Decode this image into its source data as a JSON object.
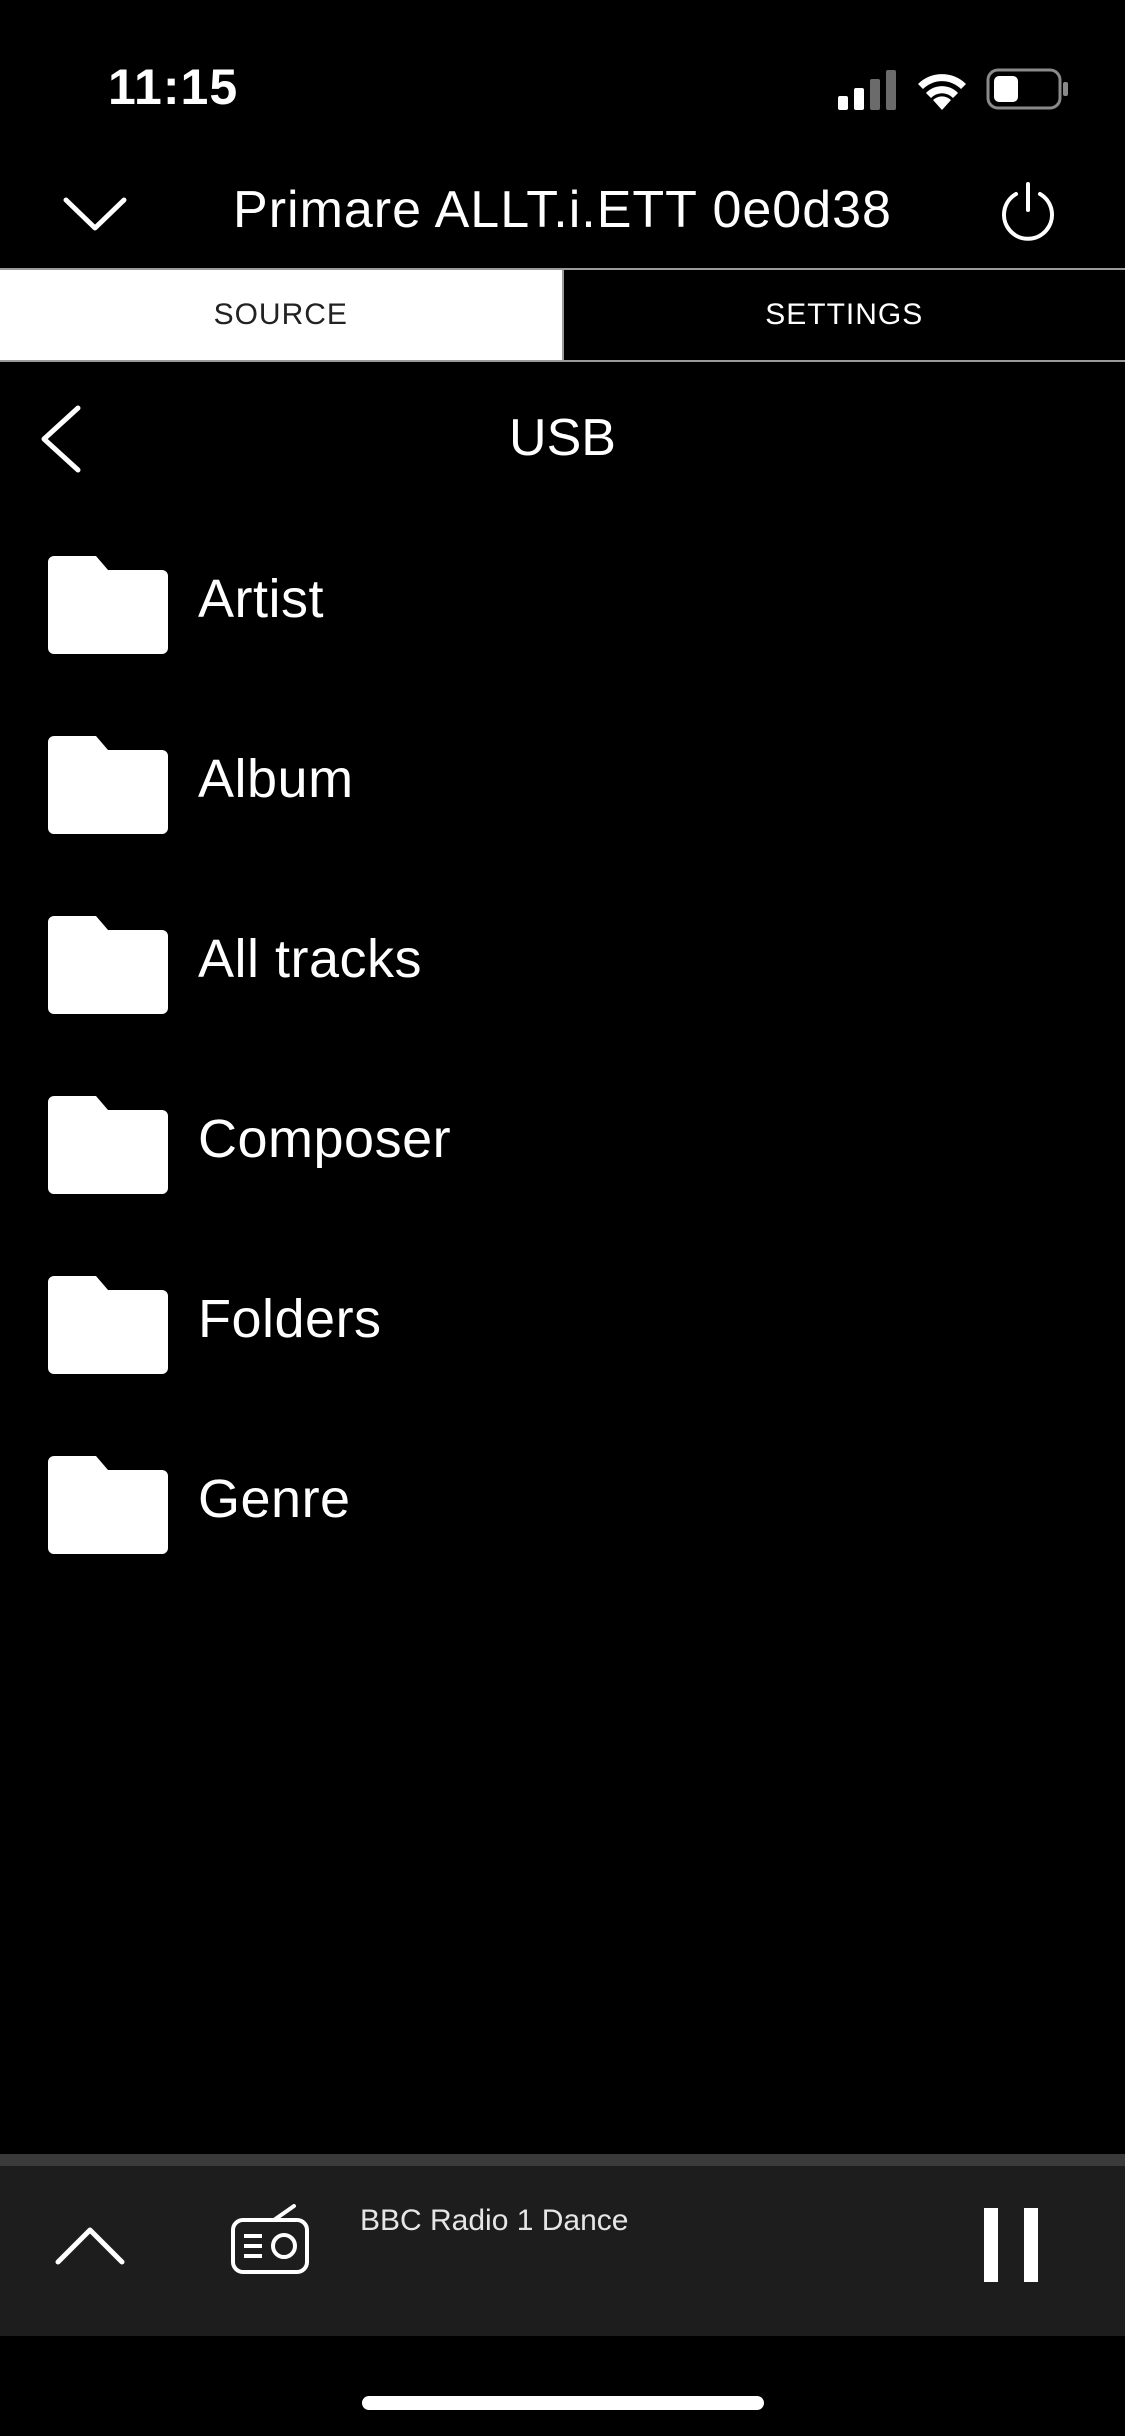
{
  "status_bar": {
    "time": "11:15",
    "signal_icon": "cellular-signal-icon",
    "wifi_icon": "wifi-icon",
    "battery_icon": "battery-icon",
    "battery_level": 0.35
  },
  "header": {
    "title": "Primare ALLT.i.ETT 0e0d38",
    "collapse_icon": "chevron-down-icon",
    "power_icon": "power-icon"
  },
  "tabs": [
    {
      "label": "SOURCE",
      "active": true
    },
    {
      "label": "SETTINGS",
      "active": false
    }
  ],
  "browser": {
    "back_icon": "chevron-left-icon",
    "title": "USB",
    "items": [
      {
        "label": "Artist",
        "icon": "folder-icon"
      },
      {
        "label": "Album",
        "icon": "folder-icon"
      },
      {
        "label": "All tracks",
        "icon": "folder-icon"
      },
      {
        "label": "Composer",
        "icon": "folder-icon"
      },
      {
        "label": "Folders",
        "icon": "folder-icon"
      },
      {
        "label": "Genre",
        "icon": "folder-icon"
      }
    ]
  },
  "player": {
    "expand_icon": "chevron-up-icon",
    "source_icon": "radio-icon",
    "station": "BBC Radio 1 Dance",
    "control_icon": "pause-icon"
  },
  "colors": {
    "background": "#000000",
    "foreground": "#ffffff",
    "player_background": "#1d1d1d",
    "divider": "#9a9a9a"
  }
}
